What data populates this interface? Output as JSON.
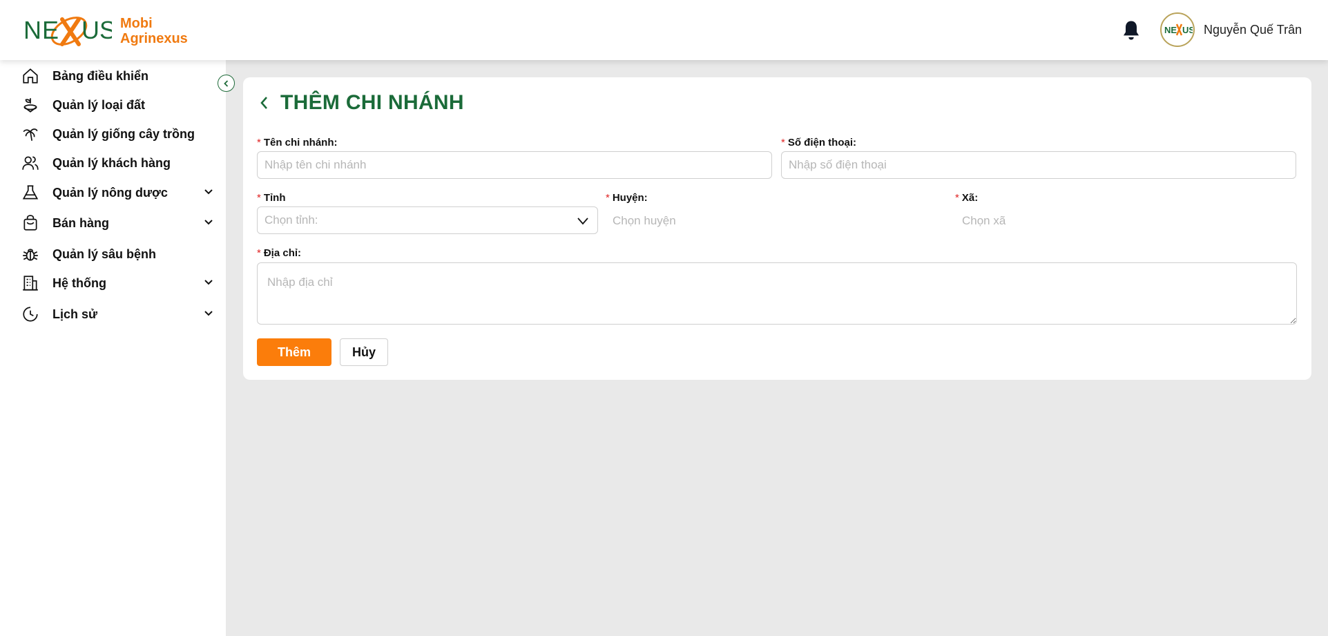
{
  "brand": {
    "logo_word": "NEXUS",
    "name_line1": "Mobi",
    "name_line2": "Agrinexus",
    "avatar_word": "NEXUS",
    "colors": {
      "green": "#1b6b39",
      "orange": "#f07a10",
      "button": "#fb7d0b"
    }
  },
  "header": {
    "username": "Nguyễn Quế Trân",
    "bell_icon": "bell-icon"
  },
  "sidebar": {
    "items": [
      {
        "label": "Bảng điều khiển",
        "icon": "home-icon",
        "expandable": false
      },
      {
        "label": "Quản lý loại đất",
        "icon": "soil-icon",
        "expandable": false
      },
      {
        "label": "Quản lý giống cây trồng",
        "icon": "palm-tree-icon",
        "expandable": false
      },
      {
        "label": "Quản lý khách hàng",
        "icon": "users-icon",
        "expandable": false
      },
      {
        "label": "Quản lý nông dược",
        "icon": "flask-icon",
        "expandable": true
      },
      {
        "label": "Bán hàng",
        "icon": "shopping-bag-icon",
        "expandable": true
      },
      {
        "label": "Quản lý sâu bệnh",
        "icon": "bug-icon",
        "expandable": false
      },
      {
        "label": "Hệ thống",
        "icon": "building-icon",
        "expandable": true
      },
      {
        "label": "Lịch sử",
        "icon": "clock-icon",
        "expandable": true
      }
    ]
  },
  "page": {
    "title": "THÊM CHI NHÁNH"
  },
  "form": {
    "required_mark": "*",
    "branch_name": {
      "label": "Tên chi nhánh:",
      "placeholder": "Nhập tên chi nhánh"
    },
    "phone": {
      "label": "Số điện thoại:",
      "placeholder": "Nhập số điện thoại"
    },
    "province": {
      "label": "Tỉnh",
      "placeholder": "Chọn tỉnh:"
    },
    "district": {
      "label": "Huyện:",
      "placeholder": "Chọn huyện"
    },
    "ward": {
      "label": "Xã:",
      "placeholder": "Chọn xã"
    },
    "address": {
      "label": "Địa chỉ:",
      "placeholder": "Nhập địa chỉ"
    },
    "submit_label": "Thêm",
    "cancel_label": "Hủy"
  }
}
